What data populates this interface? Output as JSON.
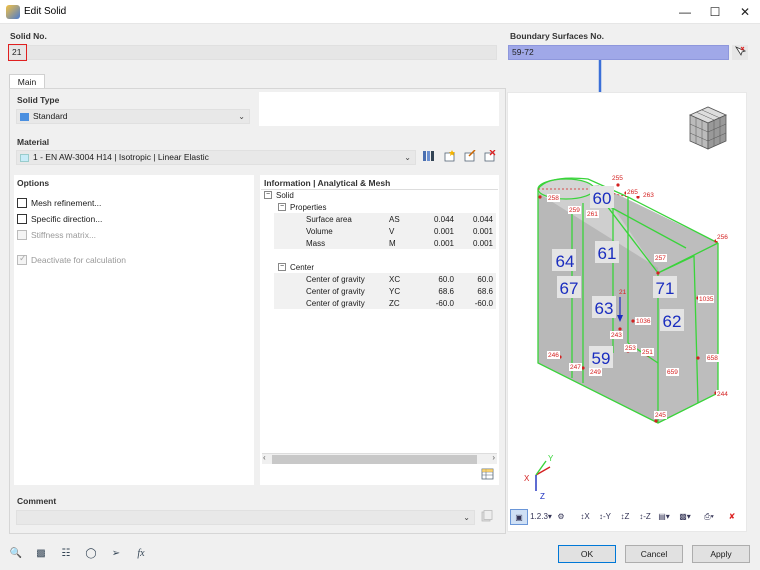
{
  "window": {
    "title": "Edit Solid"
  },
  "solid_no": {
    "label": "Solid No.",
    "value": "21"
  },
  "boundary_surfaces": {
    "label": "Boundary Surfaces No.",
    "value": "59-72"
  },
  "tabs": [
    {
      "label": "Main"
    }
  ],
  "solid_type": {
    "label": "Solid Type",
    "value": "Standard",
    "swatch_color": "#4a8fe0"
  },
  "material": {
    "label": "Material",
    "value": "1 - EN AW-3004 H14 | Isotropic | Linear Elastic",
    "swatch_color": "#c8ecf8"
  },
  "options": {
    "label": "Options",
    "items": [
      {
        "label": "Mesh refinement...",
        "checked": false,
        "disabled": false
      },
      {
        "label": "Specific direction...",
        "checked": false,
        "disabled": false
      },
      {
        "label": "Stiffness matrix...",
        "checked": false,
        "disabled": true
      },
      {
        "label": "Deactivate for calculation",
        "checked": true,
        "disabled": true
      }
    ]
  },
  "info": {
    "label": "Information | Analytical & Mesh",
    "root": "Solid",
    "groups": [
      {
        "label": "Properties",
        "rows": [
          {
            "name": "Surface area",
            "sym": "AS",
            "v1": "0.044",
            "v2": "0.044"
          },
          {
            "name": "Volume",
            "sym": "V",
            "v1": "0.001",
            "v2": "0.001"
          },
          {
            "name": "Mass",
            "sym": "M",
            "v1": "0.001",
            "v2": "0.001"
          }
        ]
      },
      {
        "label": "Center of gravity",
        "rows": [
          {
            "name": "Center of gravity",
            "sym": "XC",
            "v1": "60.0",
            "v2": "60.0"
          },
          {
            "name": "Center of gravity",
            "sym": "YC",
            "v1": "68.6",
            "v2": "68.6"
          },
          {
            "name": "Center of gravity",
            "sym": "ZC",
            "v1": "-60.0",
            "v2": "-60.0"
          }
        ]
      }
    ]
  },
  "comment": {
    "label": "Comment",
    "value": ""
  },
  "model_view": {
    "surface_labels": [
      "60",
      "61",
      "64",
      "67",
      "63",
      "71",
      "62",
      "59"
    ],
    "node_labels": [
      "255",
      "265",
      "263",
      "258",
      "259",
      "261",
      "256",
      "257",
      "1035",
      "1036",
      "243",
      "253",
      "251",
      "658",
      "659",
      "246",
      "247",
      "249",
      "245",
      "244",
      "21"
    ],
    "axes": [
      "X",
      "Y",
      "Z"
    ]
  },
  "buttons": {
    "ok": "OK",
    "cancel": "Cancel",
    "apply": "Apply"
  },
  "colors": {
    "accent": "#3a6fd8",
    "selection": "#a0a8e8",
    "highlight": "#e02020",
    "edge": "#39d43a",
    "node": "#d42020"
  }
}
